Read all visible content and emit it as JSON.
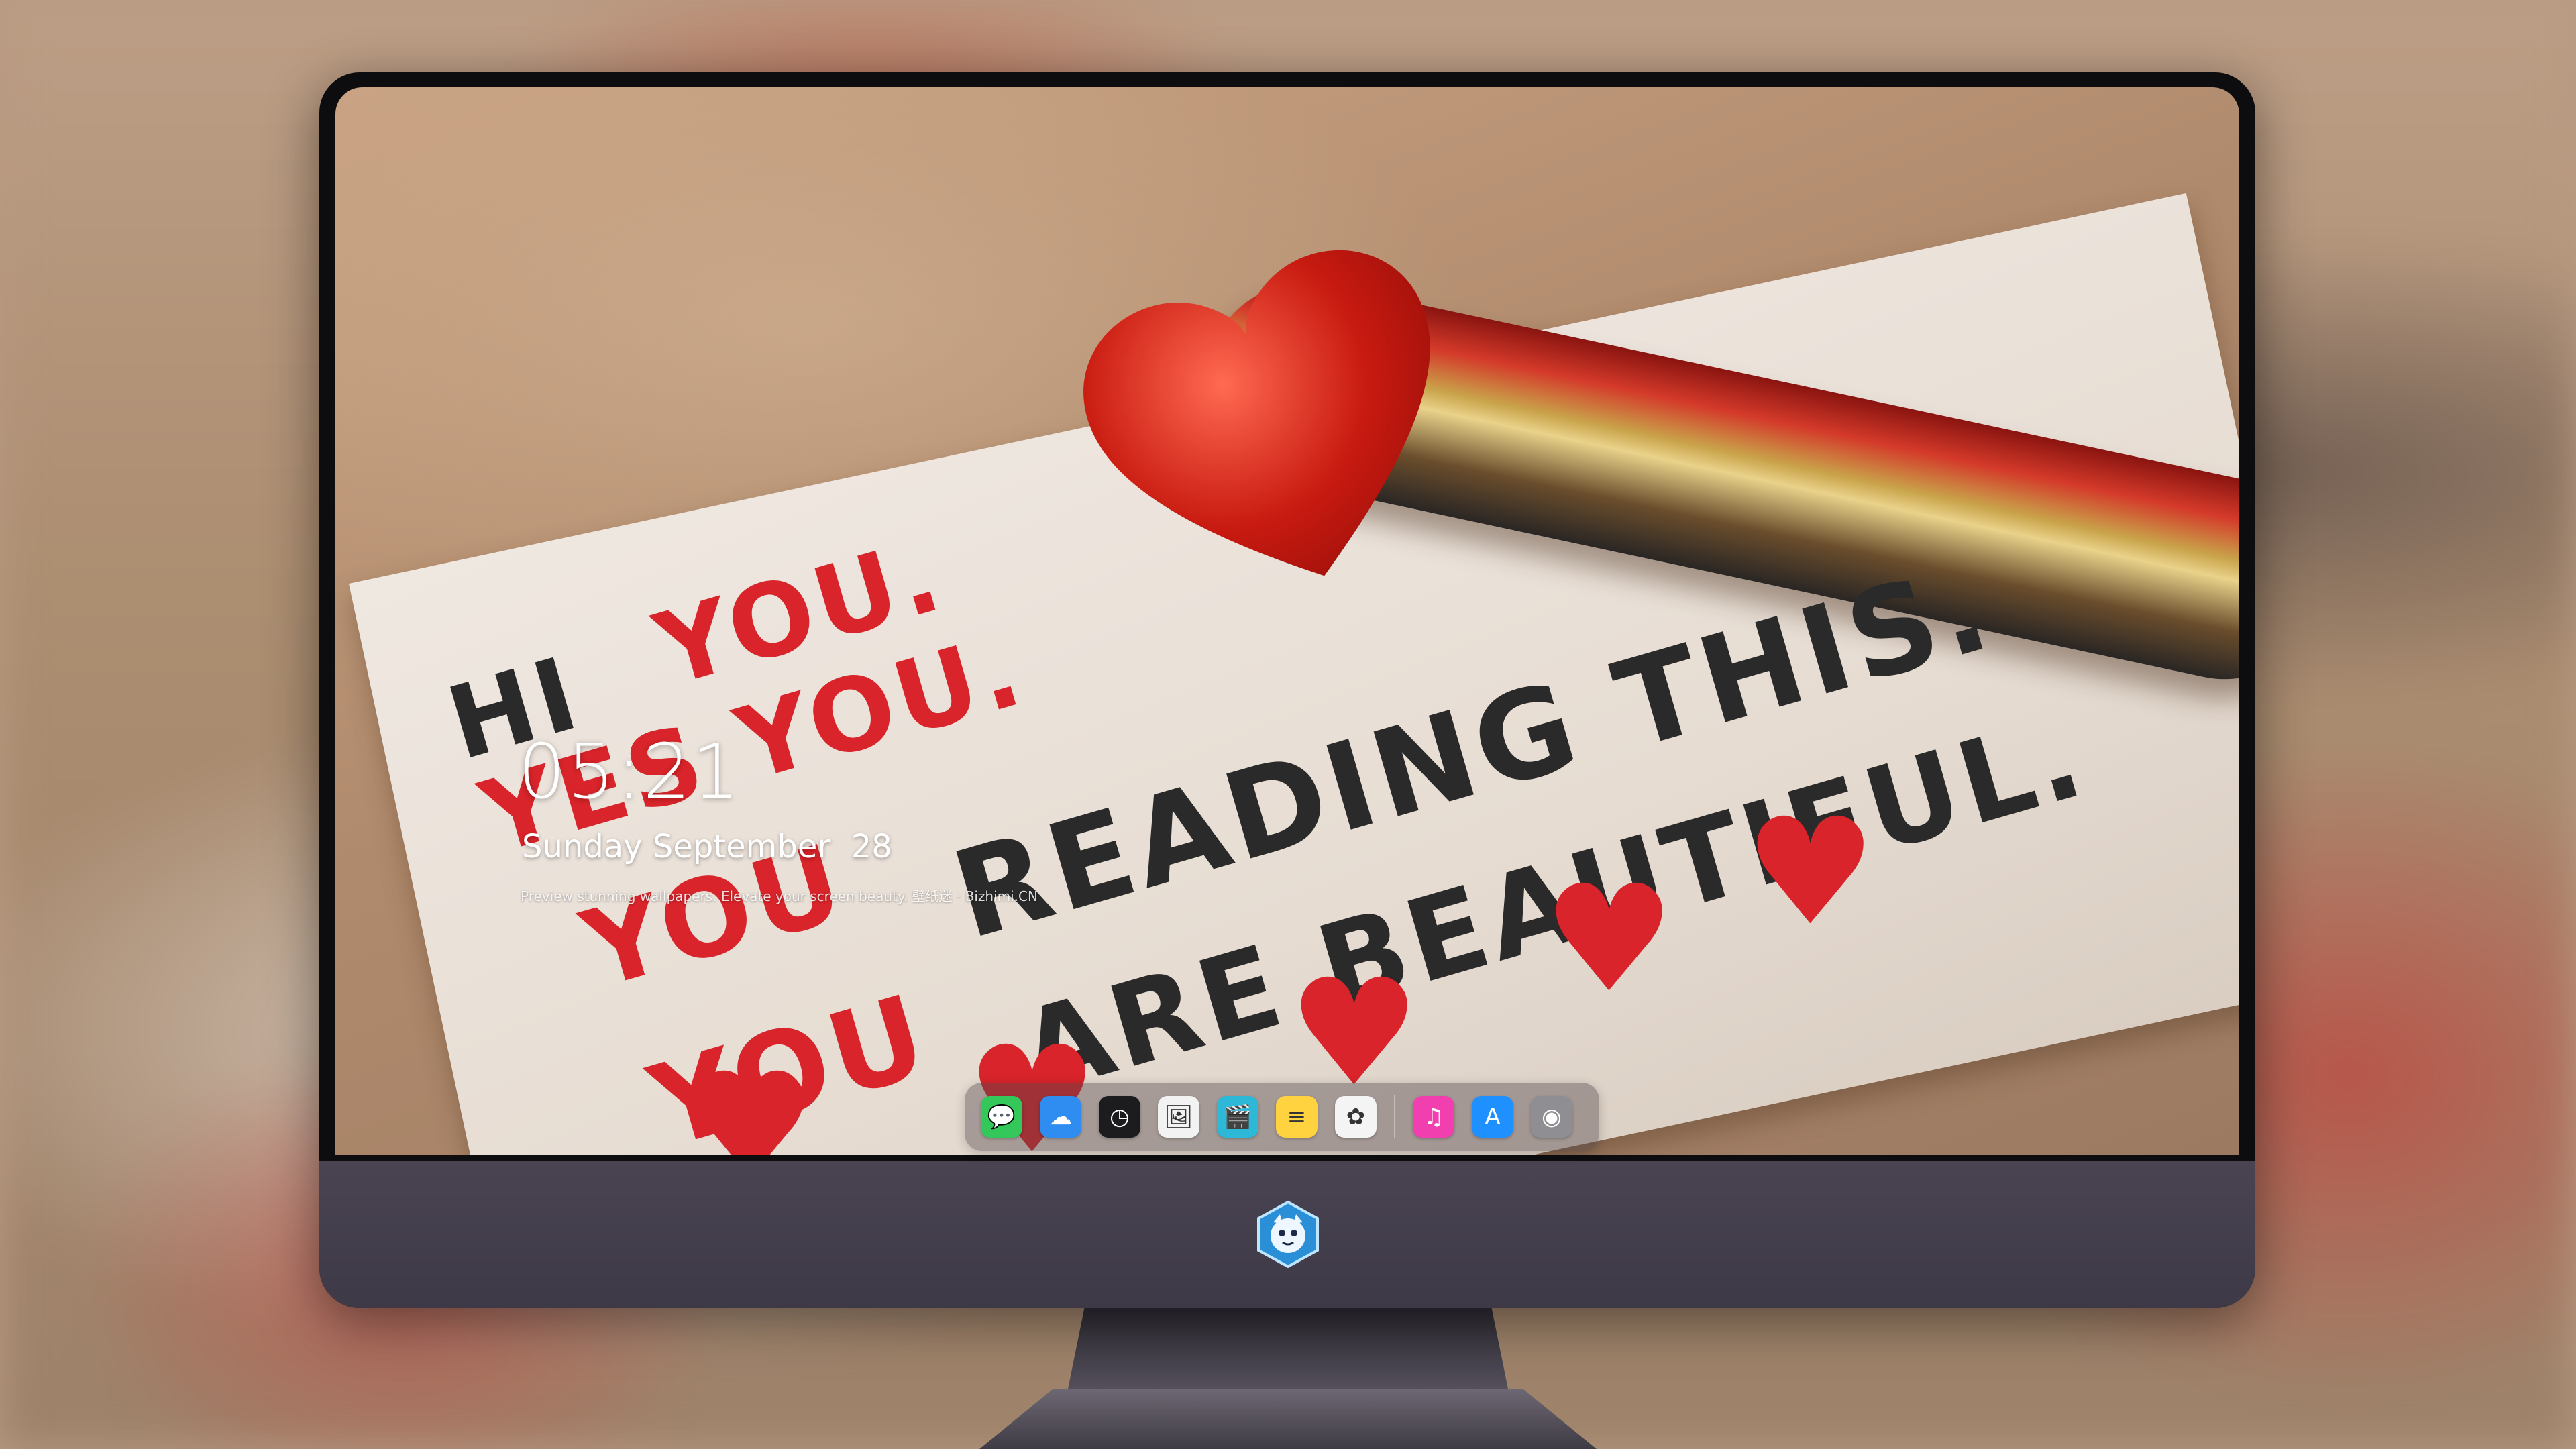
{
  "lockscreen": {
    "time": "05:21",
    "date": "Sunday September  28",
    "tagline": "Preview stunning wallpapers. Elevate your screen beauty. 壁纸迷 · Bizhimi.CN"
  },
  "wallpaper": {
    "lines": [
      "HI",
      "YOU.",
      "YES YOU.",
      "YOU",
      "READING THIS.",
      "YOU",
      "ARE BEAUTIFUL."
    ]
  },
  "dock": {
    "apps": [
      {
        "name": "messages-icon",
        "glyph": "💬",
        "color": "#34c759"
      },
      {
        "name": "weather-icon",
        "glyph": "☁",
        "color": "#2f8cf0"
      },
      {
        "name": "clock-icon",
        "glyph": "◷",
        "color": "#1c1c1e"
      },
      {
        "name": "preview-icon",
        "glyph": "🖼",
        "color": "#f2f2f2"
      },
      {
        "name": "clips-icon",
        "glyph": "🎬",
        "color": "#2db8d8"
      },
      {
        "name": "notes-icon",
        "glyph": "≡",
        "color": "#ffd23f"
      },
      {
        "name": "photos-icon",
        "glyph": "✿",
        "color": "#f4f4f4"
      },
      {
        "name": "music-icon",
        "glyph": "♫",
        "color": "#f23fb0"
      },
      {
        "name": "app-store-icon",
        "glyph": "A",
        "color": "#1e90ff"
      },
      {
        "name": "camera-icon",
        "glyph": "◉",
        "color": "#8e8e93"
      }
    ]
  },
  "colors": {
    "chin": "#443f4c",
    "bezel": "#0d0d10"
  }
}
